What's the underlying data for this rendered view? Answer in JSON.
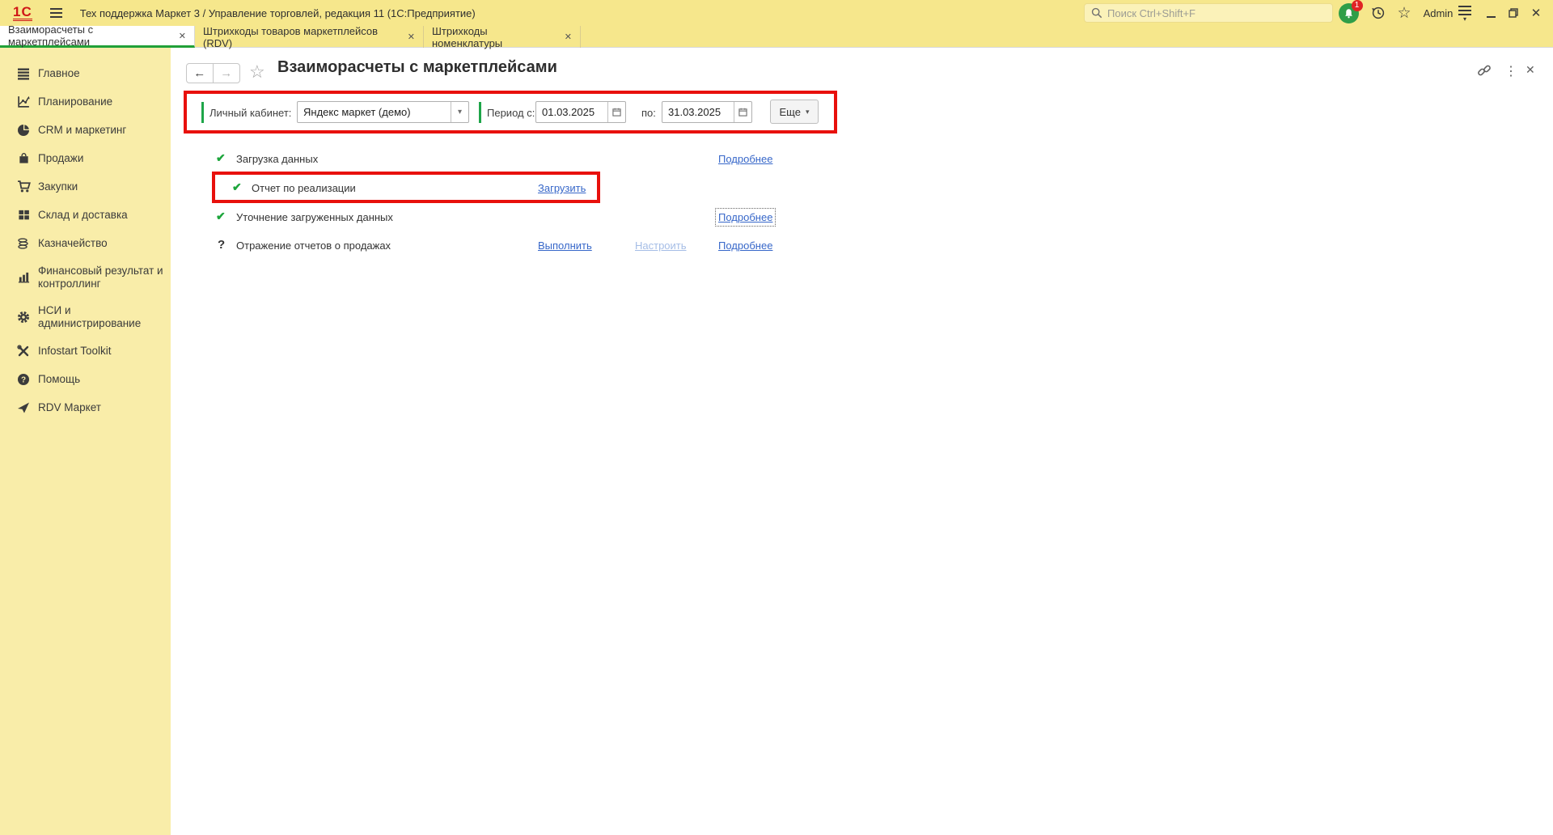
{
  "window": {
    "logo": "1С",
    "app_title": "Тех поддержка Маркет 3 / Управление торговлей, редакция 11  (1С:Предприятие)",
    "search_placeholder": "Поиск Ctrl+Shift+F",
    "notification_count": "1",
    "user": "Admin"
  },
  "tabs": [
    {
      "label": "Взаиморасчеты с маркетплейсами"
    },
    {
      "label": "Штрихкоды товаров маркетплейсов (RDV)"
    },
    {
      "label": "Штрихкоды номенклатуры"
    }
  ],
  "sidebar": {
    "items": [
      {
        "label": "Главное"
      },
      {
        "label": "Планирование"
      },
      {
        "label": "CRM и маркетинг"
      },
      {
        "label": "Продажи"
      },
      {
        "label": "Закупки"
      },
      {
        "label": "Склад и доставка"
      },
      {
        "label": "Казначейство"
      },
      {
        "label": "Финансовый результат и контроллинг"
      },
      {
        "label": "НСИ и администрирование"
      },
      {
        "label": "Infostart Toolkit"
      },
      {
        "label": "Помощь"
      },
      {
        "label": "RDV Маркет"
      }
    ]
  },
  "page": {
    "title": "Взаиморасчеты с маркетплейсами",
    "filters": {
      "cabinet_label": "Личный кабинет:",
      "cabinet_value": "Яндекс маркет (демо)",
      "period_from_label": "Период с:",
      "period_from_value": "01.03.2025",
      "period_to_label": "по:",
      "period_to_value": "31.03.2025",
      "more_button": "Еще"
    },
    "checklist": {
      "row1": {
        "label": "Загрузка данных",
        "more": "Подробнее"
      },
      "row2": {
        "label": "Отчет по реализации",
        "load": "Загрузить"
      },
      "row3": {
        "label": "Уточнение загруженных данных",
        "more": "Подробнее"
      },
      "row4": {
        "label": "Отражение отчетов о продажах",
        "run": "Выполнить",
        "configure": "Настроить",
        "more": "Подробнее"
      }
    }
  },
  "icons": {
    "check": "✔",
    "question": "?",
    "dropdown": "▾",
    "close": "✕",
    "star": "☆",
    "back": "←",
    "forward": "→",
    "kebab": "⋮"
  },
  "colors": {
    "accent_green": "#21a038",
    "annotation_red": "#e8100c",
    "link_blue": "#3767c9",
    "topbar_yellow": "#f6e78c",
    "sidebar_yellow": "#f9eda9"
  }
}
